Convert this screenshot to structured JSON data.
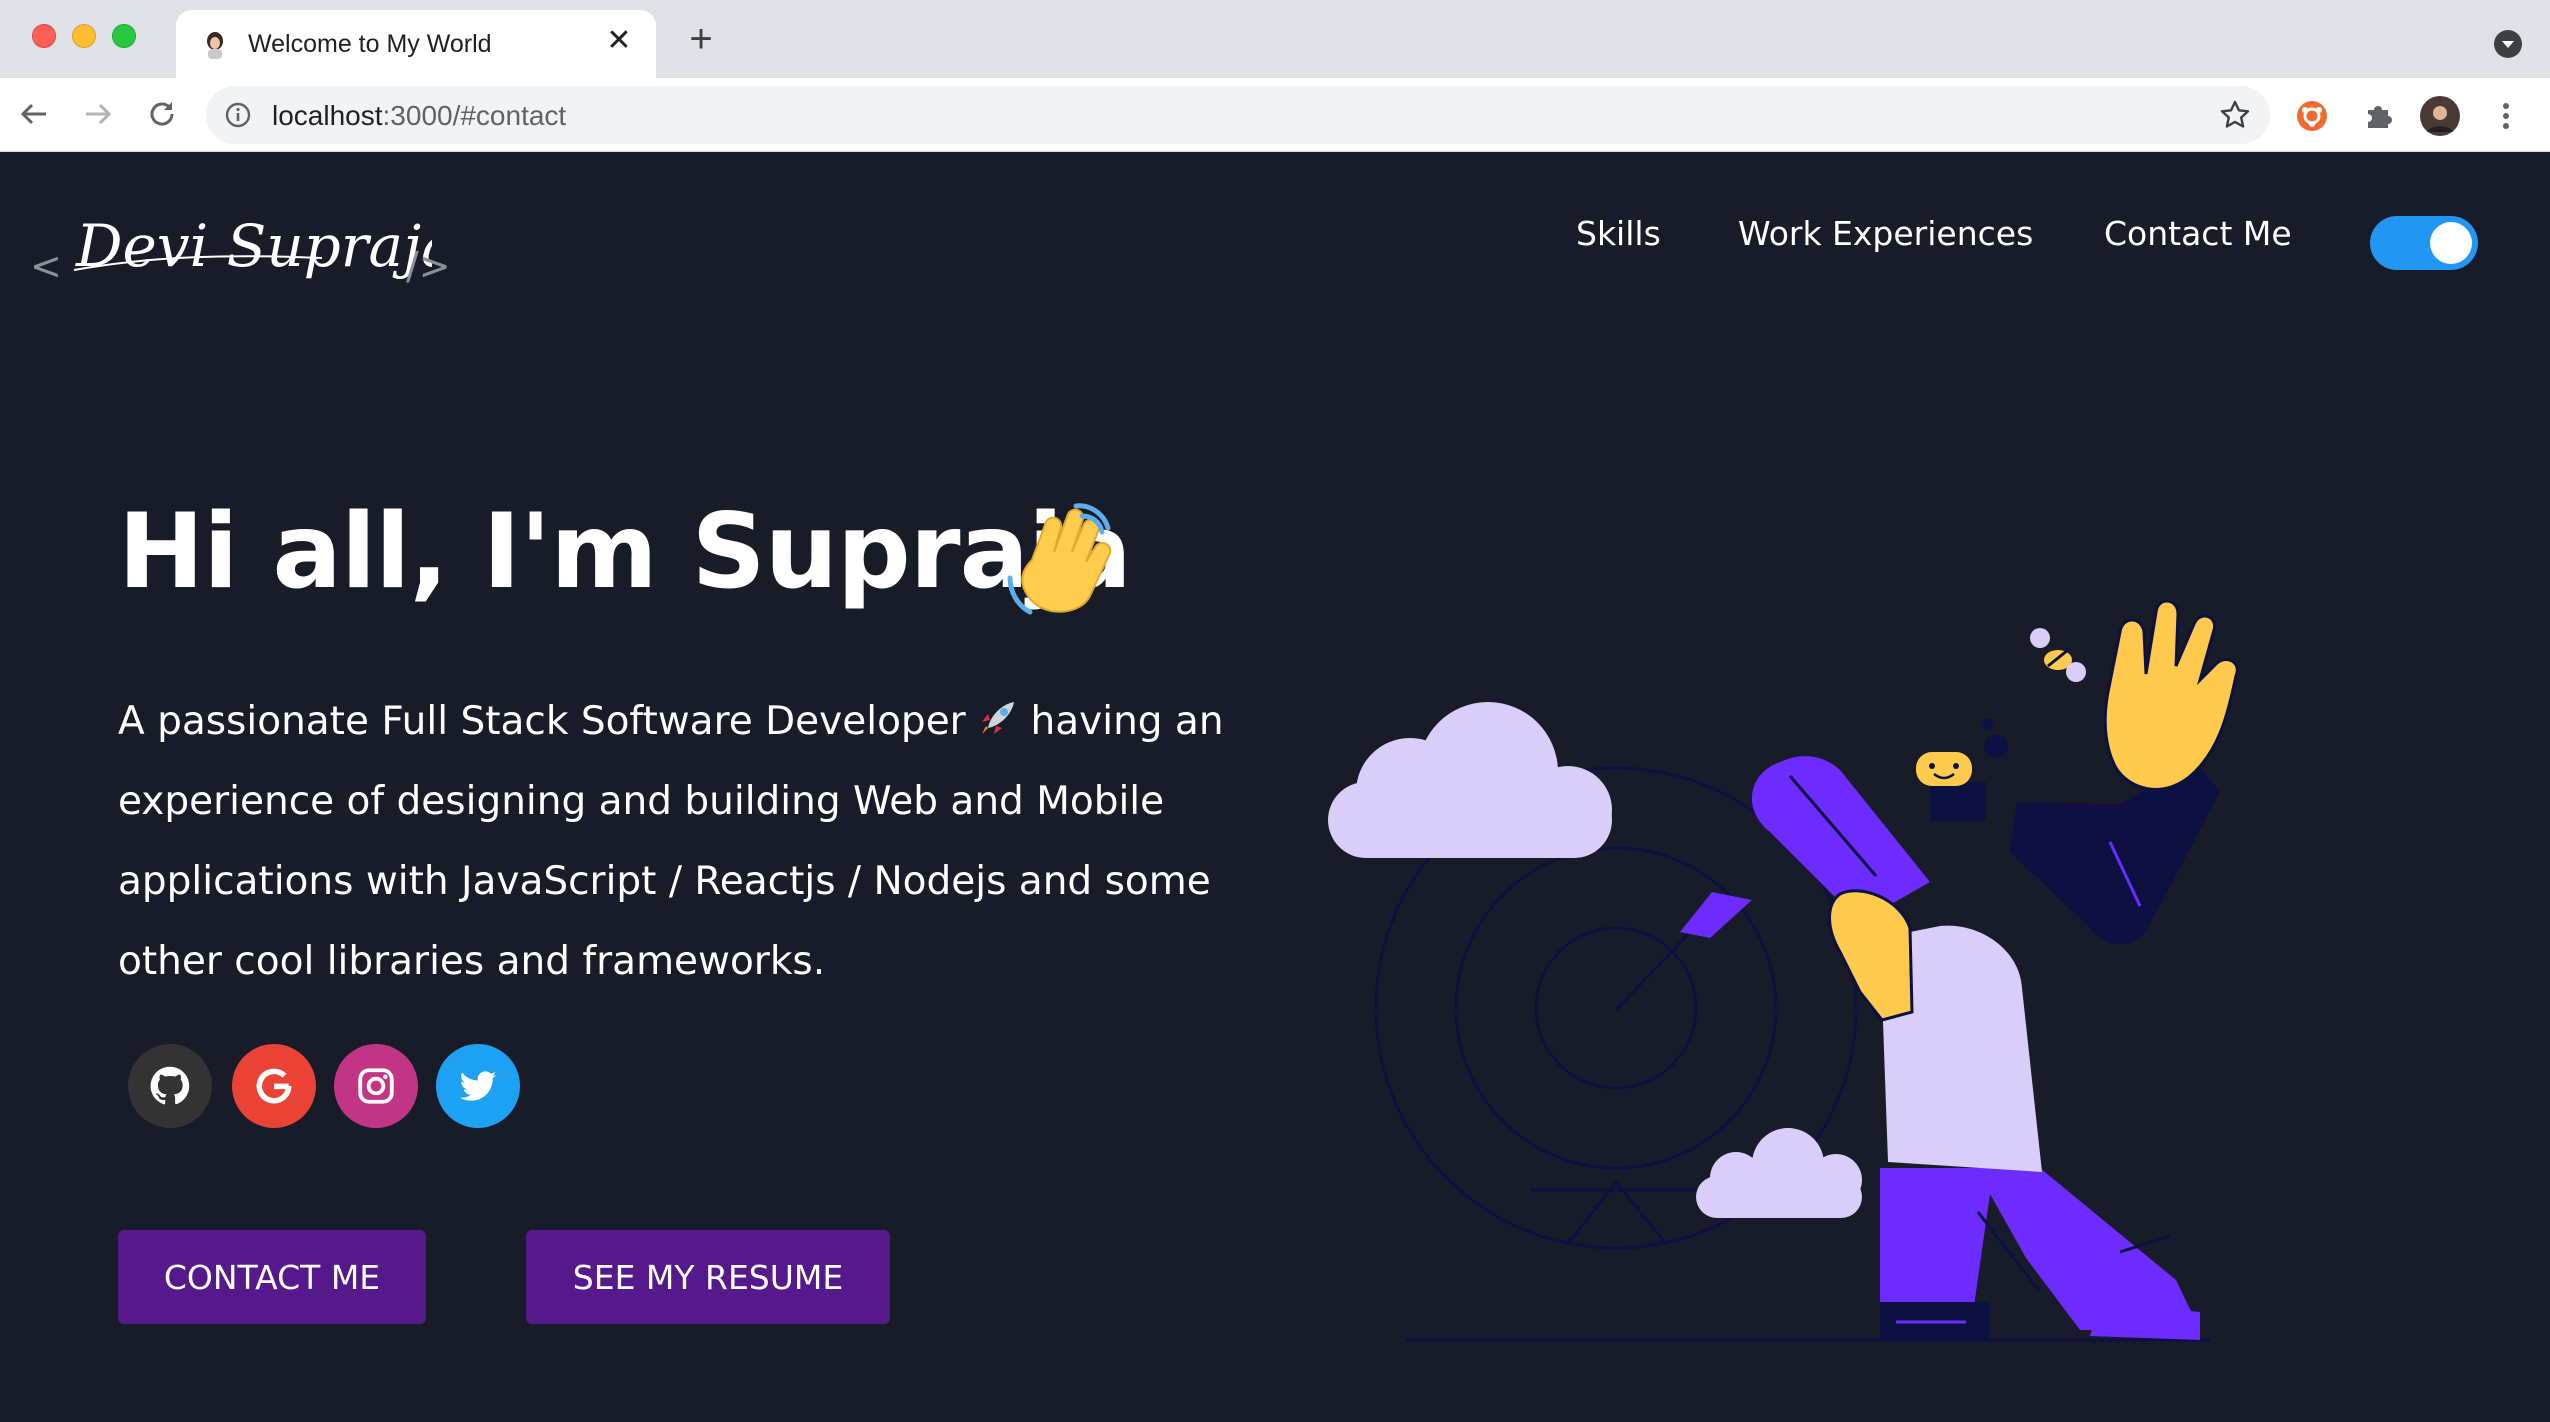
{
  "browser": {
    "tab_title": "Welcome to My World",
    "new_tab_label": "+",
    "close_label": "✕",
    "url_host": "localhost",
    "url_rest": ":3000/#contact"
  },
  "header": {
    "logo_open": "<",
    "logo_name": "Devi Supraja",
    "logo_close": "/>",
    "nav": [
      "Skills",
      "Work Experiences",
      "Contact Me"
    ],
    "theme_toggle_on": true
  },
  "hero": {
    "greeting": "Hi all, I'm Supraja",
    "intro_before": "A passionate Full Stack Software Developer",
    "intro_after": "having an experience of designing and building Web and Mobile applications with JavaScript / Reactjs / Nodejs and some other cool libraries and frameworks.",
    "social": [
      {
        "name": "github-icon",
        "color": "#333333"
      },
      {
        "name": "google-icon",
        "color": "#ea4335"
      },
      {
        "name": "instagram-icon",
        "color": "#c13584"
      },
      {
        "name": "twitter-icon",
        "color": "#1da1f2"
      }
    ],
    "buttons": {
      "contact": "CONTACT ME",
      "resume": "SEE MY RESUME"
    }
  },
  "colors": {
    "background": "#171c28",
    "button": "#55198b",
    "toggle": "#2196f3",
    "accent": "#6c2bff"
  }
}
